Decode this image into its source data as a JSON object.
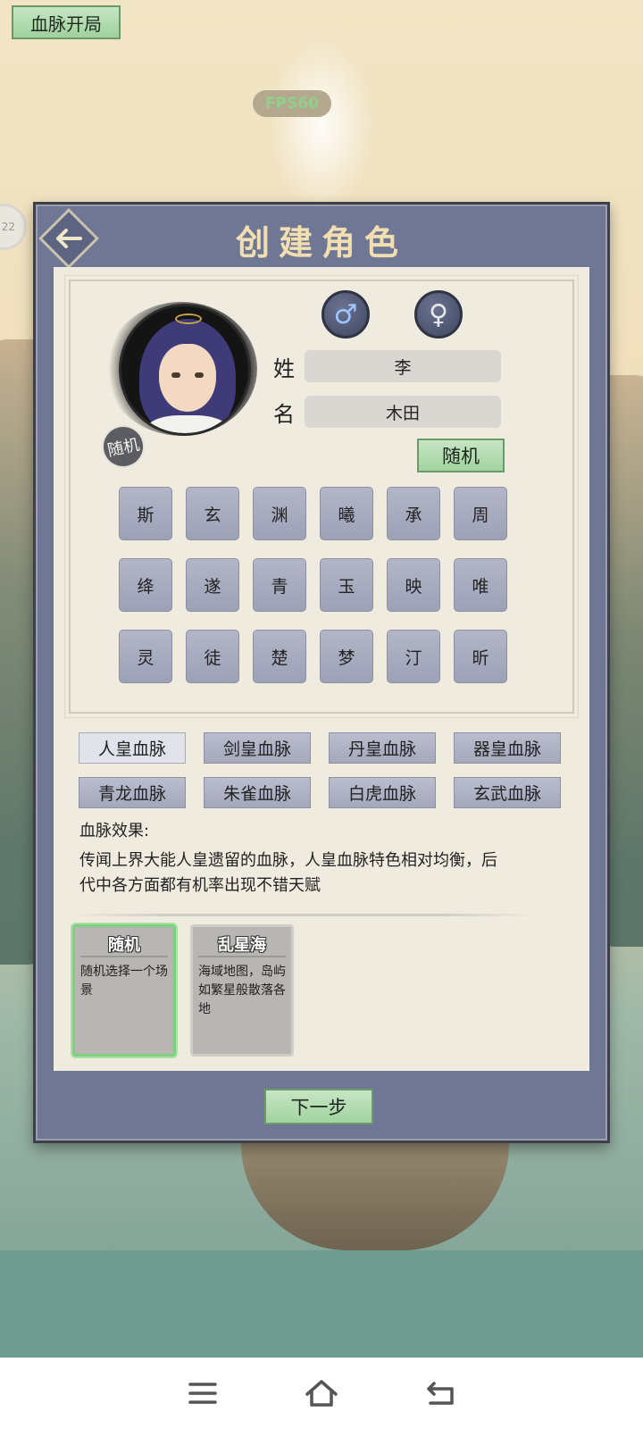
{
  "top": {
    "title_button": "血脉开局",
    "fps": "FPS60",
    "side_badge": "22"
  },
  "modal": {
    "title": "创建角色",
    "back_icon": "arrow-left-icon",
    "avatar_badge": "随机",
    "gender": {
      "male_icon": "male-symbol-icon",
      "female_icon": "female-symbol-icon",
      "male_symbol": "♂",
      "female_symbol": "♀"
    },
    "surname_label": "姓",
    "surname_value": "李",
    "name_label": "名",
    "name_value": "木田",
    "random_button": "随机",
    "name_chars": [
      "斯",
      "玄",
      "渊",
      "曦",
      "承",
      "周",
      "绛",
      "遂",
      "青",
      "玉",
      "映",
      "唯",
      "灵",
      "徒",
      "楚",
      "梦",
      "汀",
      "昕"
    ],
    "bloodlines": [
      {
        "label": "人皇血脉",
        "selected": true
      },
      {
        "label": "剑皇血脉",
        "selected": false
      },
      {
        "label": "丹皇血脉",
        "selected": false
      },
      {
        "label": "器皇血脉",
        "selected": false
      },
      {
        "label": "青龙血脉",
        "selected": false
      },
      {
        "label": "朱雀血脉",
        "selected": false
      },
      {
        "label": "白虎血脉",
        "selected": false
      },
      {
        "label": "玄武血脉",
        "selected": false
      }
    ],
    "effect_title": "血脉效果:",
    "effect_text": "传闻上界大能人皇遗留的血脉，人皇血脉特色相对均衡，后代中各方面都有机率出现不错天赋",
    "scenes": [
      {
        "name": "随机",
        "desc": "随机选择一个场景",
        "selected": true
      },
      {
        "name": "乱星海",
        "desc": "海域地图，岛屿如繁星般散落各地",
        "selected": false
      }
    ],
    "next_button": "下一步"
  },
  "navbar": {
    "menu_icon": "menu-icon",
    "home_icon": "home-icon",
    "back_icon": "back-icon"
  },
  "colors": {
    "modal_bg": "#6f7794",
    "panel_bg": "#efebdf",
    "green_button": "#a2d3a0",
    "char_tile": "#a5a8bb",
    "title_gold": "#f1dfb2"
  }
}
